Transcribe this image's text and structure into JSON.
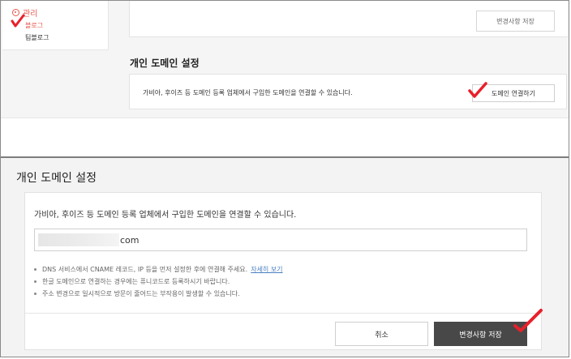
{
  "top": {
    "side_menu": {
      "management": "관리",
      "blog": "블로그",
      "teamblog": "팀블로그"
    },
    "save_button": "변경사항 저장",
    "domain_section_title": "개인 도메인 설정",
    "domain_description": "가비아, 후이즈 등 도메인 등록 업체에서 구입한 도메인을 연결할 수 있습니다.",
    "connect_button": "도메인 연결하기"
  },
  "form": {
    "title": "개인 도메인 설정",
    "description": "가비아, 후이즈 등 도메인 등록 업체에서 구입한 도메인을 연결할 수 있습니다.",
    "domain_value_suffix": "com",
    "notes": [
      {
        "text": "DNS 서비스에서 CNAME 레코드, IP 등을 먼저 설정한 후에 연결해 주세요.",
        "link": "자세히 보기"
      },
      {
        "text": "한글 도메인으로 연결하는 경우에는 퓨니코드로 등록하시기 바랍니다."
      },
      {
        "text": "주소 변경으로 일시적으로 방문이 줄어드는 부작용이 발생할 수 있습니다."
      }
    ],
    "cancel_button": "취소",
    "save_button": "변경사항 저장"
  },
  "colors": {
    "accent_red": "#e9574c",
    "check_red": "#e8202a",
    "dark_button": "#484848",
    "link_blue": "#4a7fc1"
  },
  "icons": {
    "settings": "gear-icon",
    "checkmark": "checkmark-icon"
  }
}
